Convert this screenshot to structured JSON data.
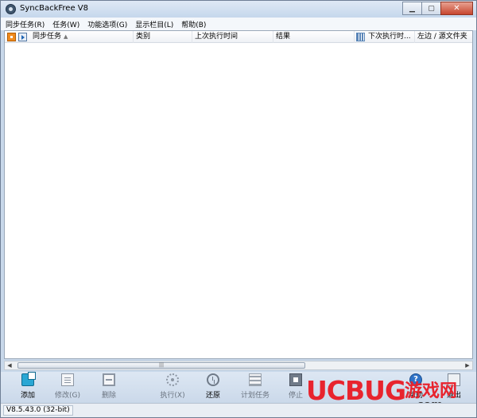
{
  "window": {
    "title": "SyncBackFree V8",
    "controls": {
      "minimize": "▁",
      "maximize": "▢",
      "close": "✕"
    }
  },
  "menu": [
    "同步任务(R)",
    "任务(W)",
    "功能选项(G)",
    "显示栏目(L)",
    "帮助(B)"
  ],
  "list": {
    "columns": [
      "同步任务",
      "类别",
      "上次执行时间",
      "结果",
      "下次执行时...",
      "左边 / 源文件夹"
    ],
    "sort_indicator": "▲",
    "rows": []
  },
  "scrollbar": {
    "left_arrow": "◀",
    "right_arrow": "▶",
    "grip": "|||"
  },
  "toolbar": {
    "add": "添加",
    "edit": "修改(G)",
    "delete": "删除",
    "run": "执行(X)",
    "restore": "还原",
    "schedule": "计划任务",
    "stop": "停止",
    "help": "帮助",
    "exit": "退出"
  },
  "watermark": {
    "brand": "UCBUG",
    "cn": "游戏网",
    "domain": ".com"
  },
  "status": {
    "version": "V8.5.43.0 (32-bit)"
  }
}
